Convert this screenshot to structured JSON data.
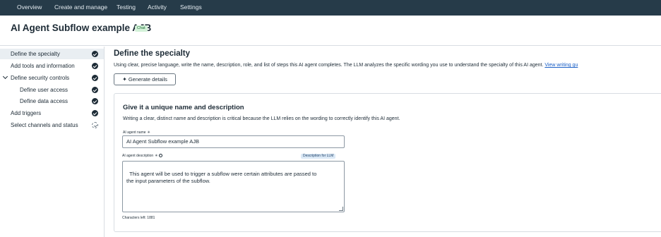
{
  "topnav": {
    "tabs": [
      {
        "label": "Overview"
      },
      {
        "label": "Create and manage"
      },
      {
        "label": "Testing"
      },
      {
        "label": "Activity"
      },
      {
        "label": "Settings"
      }
    ]
  },
  "header": {
    "title": "AI Agent Subflow example AJB",
    "badge": "Chat"
  },
  "sidebar": {
    "items": [
      {
        "label": "Define the specialty",
        "status": "done",
        "active": true
      },
      {
        "label": "Add tools and information",
        "status": "done"
      },
      {
        "label": "Define security controls",
        "status": "done",
        "expanded": true
      },
      {
        "label": "Define user access",
        "status": "done"
      },
      {
        "label": "Define data access",
        "status": "done"
      },
      {
        "label": "Add triggers",
        "status": "done"
      },
      {
        "label": "Select channels and status",
        "status": "pending"
      }
    ]
  },
  "main": {
    "title": "Define the specialty",
    "description": "Using clear, precise language, write the name, description, role, and list of steps this AI agent completes. The LLM analyzes the specific wording you use to understand the specialty of this AI agent.",
    "link": "View writing gu",
    "generate_button": "Generate details"
  },
  "card": {
    "title": "Give it a unique name and description",
    "description": "Writing a clear, distinct name and description is critical because the LLM relies on the wording to correctly identify this AI agent.",
    "name_label": "AI agent name",
    "name_value": "AI Agent Subflow example AJB",
    "desc_label": "AI agent description",
    "llm_badge": "Description for LLM",
    "desc_value": "This agent will be used to trigger a subflow were certain attributes are passed to\nthe input parameters of the subflow.",
    "chars_left": "Characters left: 1881"
  },
  "colors": {
    "topnav_bg": "#263b49",
    "active_item_bg": "#e9eef2",
    "link": "#1a5fc6",
    "chat_badge_bg": "#d3f1d8",
    "llm_badge_bg": "#dbe9f6"
  },
  "icons": {
    "step_done": "check-circle-icon",
    "step_pending": "dashed-check-circle-icon",
    "expand": "chevron-down-icon",
    "generate": "sparkle-icon",
    "info": "info-icon"
  }
}
